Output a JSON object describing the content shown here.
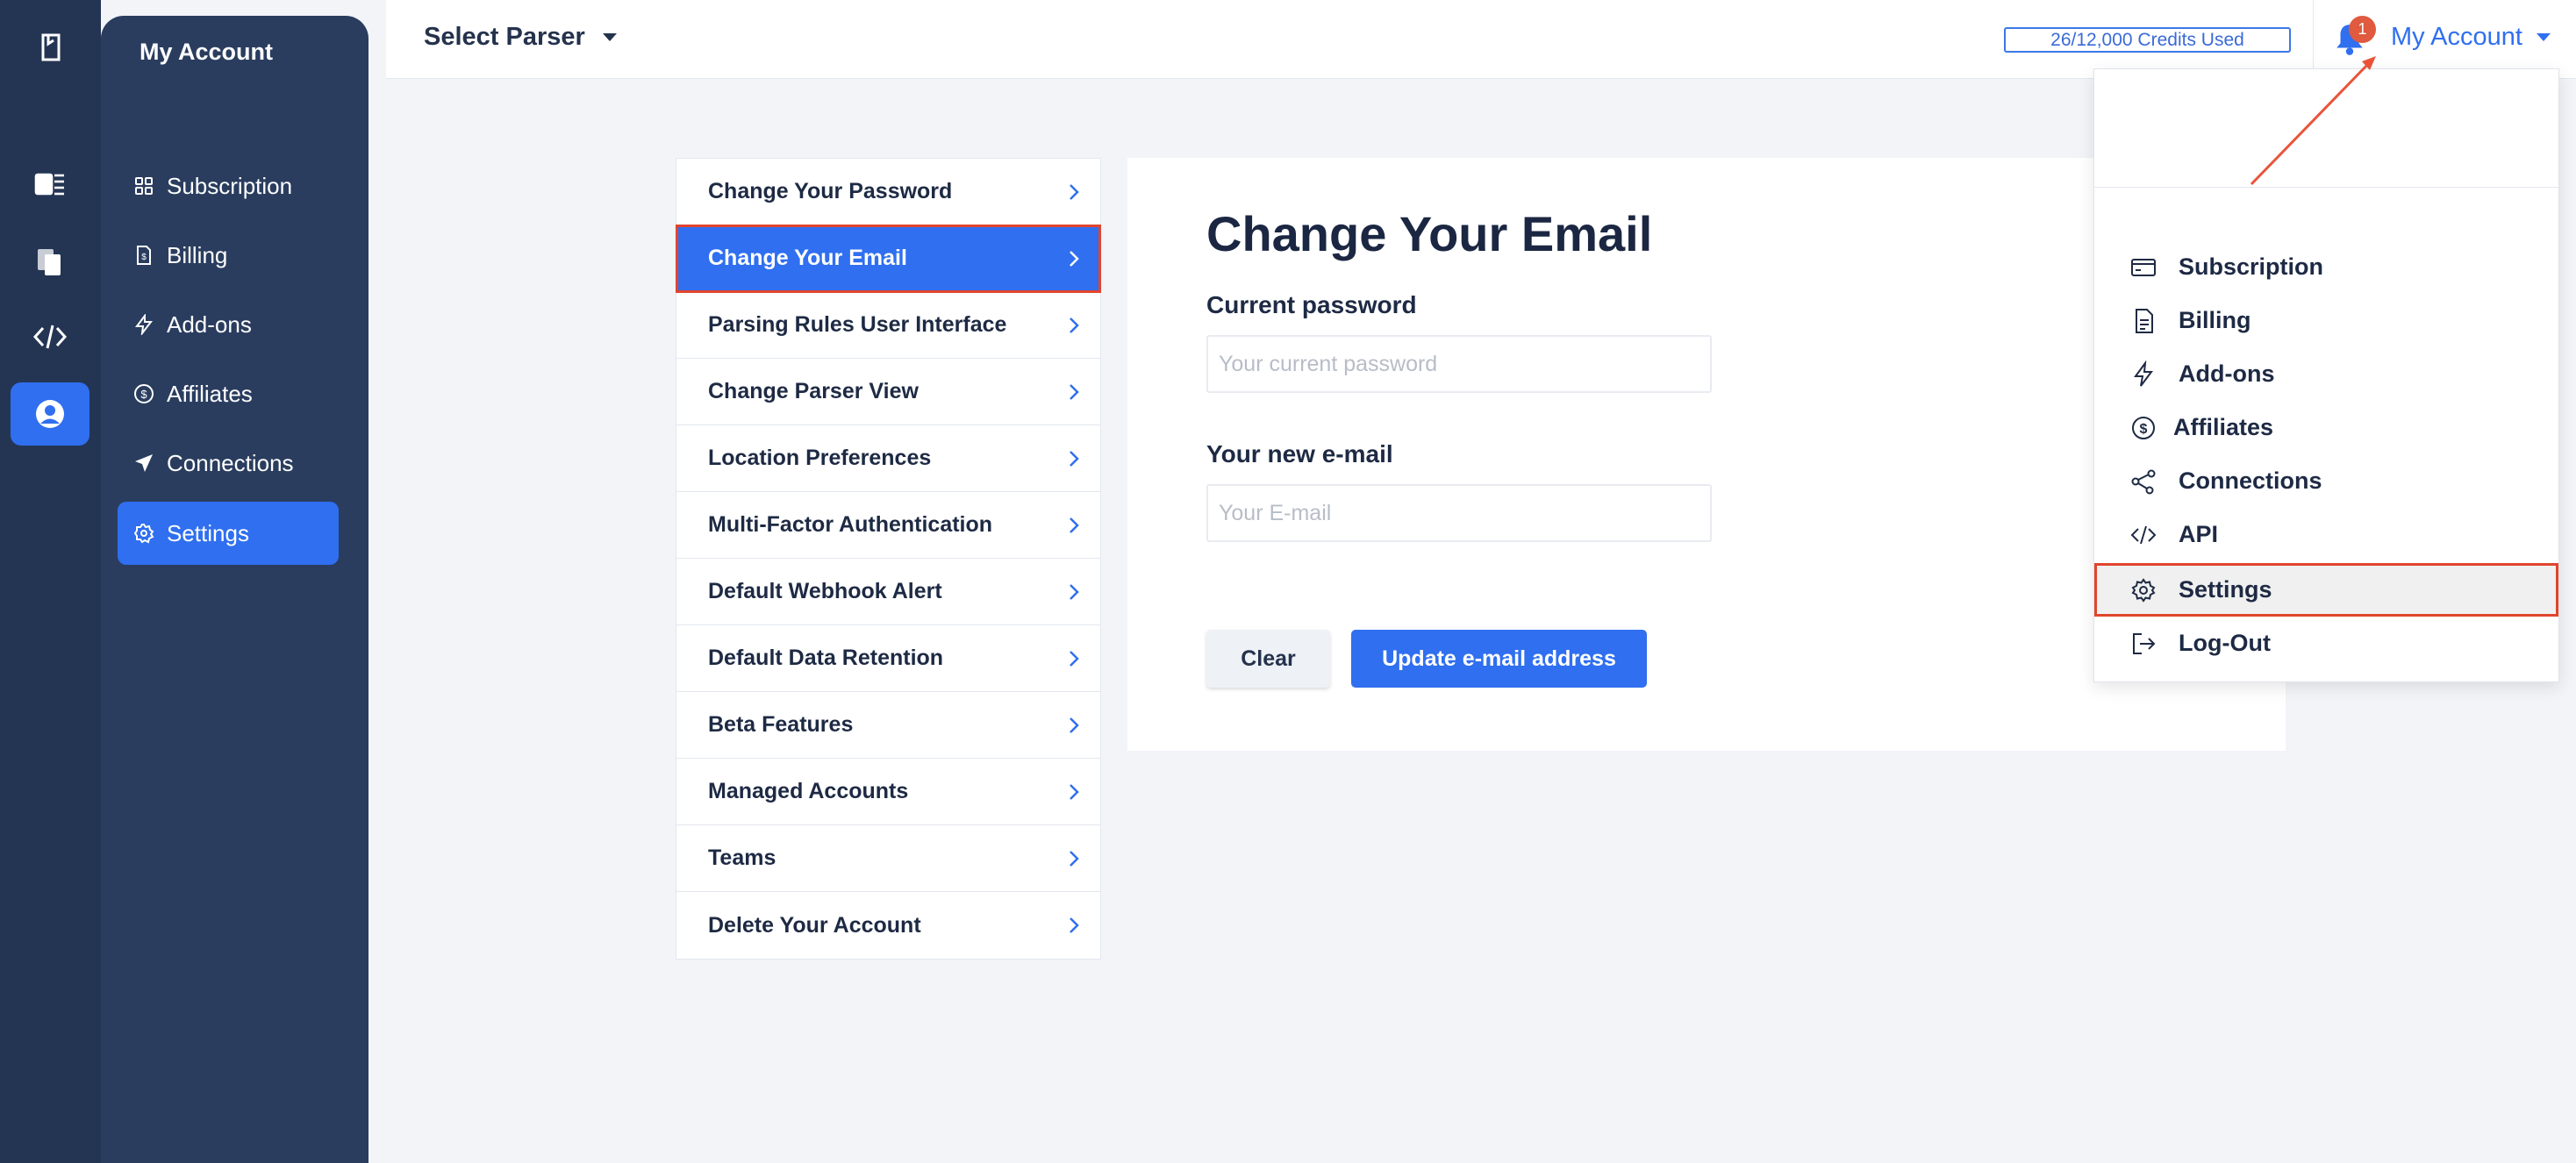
{
  "rail": {
    "items": [
      {
        "icon": "logo-icon"
      },
      {
        "icon": "parsers-icon"
      },
      {
        "icon": "documents-icon"
      },
      {
        "icon": "code-icon"
      },
      {
        "icon": "account-icon",
        "active": true
      }
    ]
  },
  "sidebar": {
    "title": "My Account",
    "items": [
      {
        "label": "Subscription",
        "icon": "grid-icon"
      },
      {
        "label": "Billing",
        "icon": "invoice-icon"
      },
      {
        "label": "Add-ons",
        "icon": "bolt-icon"
      },
      {
        "label": "Affiliates",
        "icon": "dollar-circle-icon"
      },
      {
        "label": "Connections",
        "icon": "send-icon"
      },
      {
        "label": "Settings",
        "icon": "gear-icon",
        "active": true
      }
    ]
  },
  "topbar": {
    "parser_label": "Select Parser",
    "credits": "26/12,000 Credits Used",
    "notification_count": "1",
    "account_label": "My Account"
  },
  "settings_menu": {
    "items": [
      {
        "label": "Change Your Password"
      },
      {
        "label": "Change Your Email",
        "active": true
      },
      {
        "label": "Parsing Rules User Interface"
      },
      {
        "label": "Change Parser View"
      },
      {
        "label": "Location Preferences"
      },
      {
        "label": "Multi-Factor Authentication"
      },
      {
        "label": "Default Webhook Alert"
      },
      {
        "label": "Default Data Retention"
      },
      {
        "label": "Beta Features"
      },
      {
        "label": "Managed Accounts"
      },
      {
        "label": "Teams"
      },
      {
        "label": "Delete Your Account"
      }
    ]
  },
  "form": {
    "title": "Change Your Email",
    "current_password_label": "Current password",
    "current_password_placeholder": "Your current password",
    "current_password_value": "",
    "new_email_label": "Your new e-mail",
    "new_email_placeholder": "Your E-mail",
    "new_email_value": "",
    "clear_label": "Clear",
    "update_label": "Update e-mail address"
  },
  "account_dropdown": {
    "items": [
      {
        "label": "Subscription",
        "icon": "card-icon"
      },
      {
        "label": "Billing",
        "icon": "document-icon"
      },
      {
        "label": "Add-ons",
        "icon": "bolt-icon"
      },
      {
        "label": "Affiliates",
        "icon": "dollar-circle-icon"
      },
      {
        "label": "Connections",
        "icon": "share-icon"
      },
      {
        "label": "API",
        "icon": "code-icon"
      },
      {
        "label": "Settings",
        "icon": "gear-icon",
        "active": true
      },
      {
        "label": "Log-Out",
        "icon": "logout-icon"
      }
    ]
  },
  "colors": {
    "primary": "#2f6ff0",
    "rail_bg": "#243554",
    "sidebar_bg": "#2a3d5f",
    "highlight_outline": "#e0452d",
    "badge": "#df5a3e"
  }
}
